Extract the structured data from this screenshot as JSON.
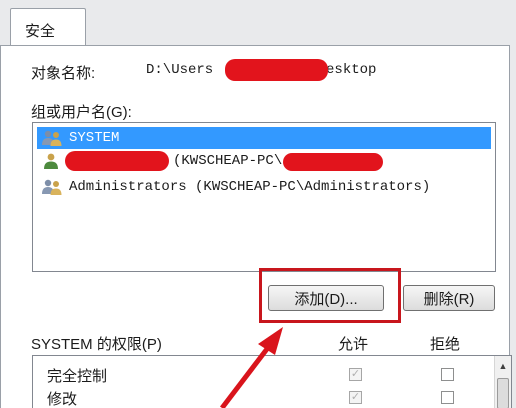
{
  "tab": {
    "label": "安全"
  },
  "object": {
    "label": "对象名称:",
    "path_prefix": "D:\\Users",
    "path_suffix": "\\Desktop"
  },
  "group": {
    "label": "组或用户名(G):",
    "entries": [
      {
        "name": "SYSTEM",
        "selected": true,
        "icon": "group-users-icon"
      },
      {
        "name": "(KWSCHEAP-PC\\",
        "selected": false,
        "icon": "single-user-icon"
      },
      {
        "name": "Administrators (KWSCHEAP-PC\\Administrators)",
        "selected": false,
        "icon": "group-users-icon"
      }
    ]
  },
  "buttons": {
    "add": "添加(D)...",
    "remove": "删除(R)"
  },
  "permissions": {
    "title": "SYSTEM 的权限(P)",
    "allow_label": "允许",
    "deny_label": "拒绝",
    "rows": [
      {
        "name": "完全控制",
        "allow": true,
        "deny": false
      },
      {
        "name": "修改",
        "allow": true,
        "deny": false
      }
    ]
  },
  "colors": {
    "selection": "#3399ff",
    "redaction": "#e2141c",
    "annotation": "#c8161d"
  }
}
